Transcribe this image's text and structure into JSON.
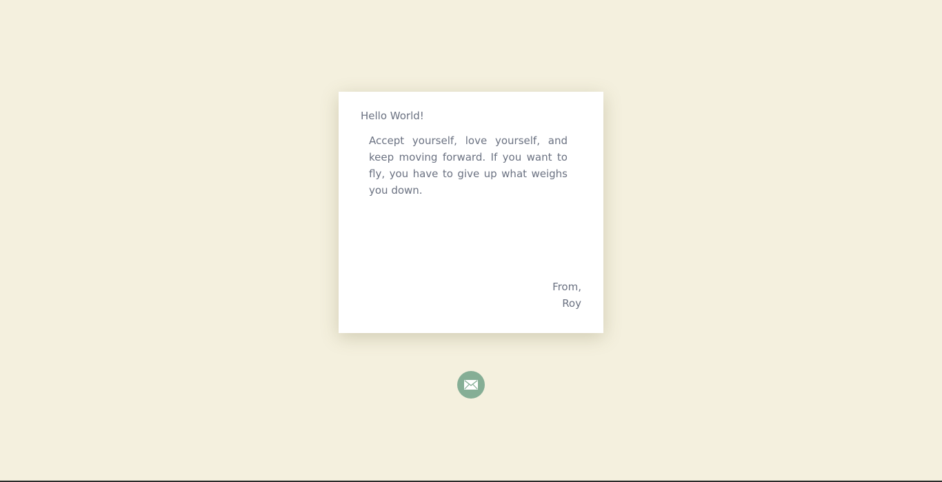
{
  "letter": {
    "greeting": "Hello World!",
    "message": "Accept yourself, love yourself, and keep moving forward. If you want to fly, you have to give up what weighs you down.",
    "signoff_line1": "From,",
    "signoff_line2": "Roy"
  },
  "mail_button": {
    "icon": "envelope-icon"
  },
  "colors": {
    "background": "#f4f0de",
    "card": "#ffffff",
    "text": "#6a7181",
    "accent": "#85ae95"
  }
}
